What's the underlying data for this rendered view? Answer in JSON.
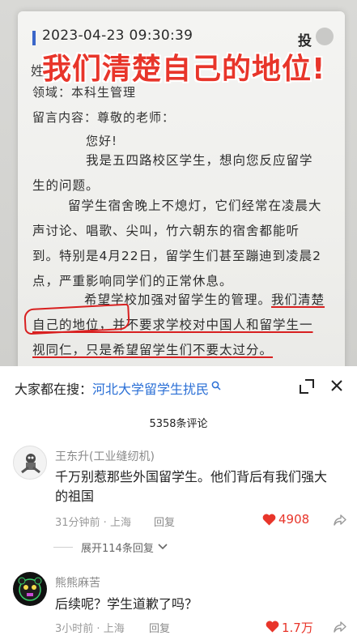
{
  "photo": {
    "timestamp": "2023-04-23 09:30:39",
    "header_right": "投",
    "overlay_title": "我们清楚自己的地位!",
    "field_partial": "姓",
    "domain_line": "领域：本科生管理",
    "content_label": "留言内容：尊敬的老师：",
    "greeting": "您好!",
    "para1": "我是五四路校区学生，想向您反应留学生的问题。",
    "para2": "留学生宿舍晚上不熄灯，它们经常在凌晨大声讨论、唱歌、尖叫，竹六朝东的宿舍都能听到。特别是4月22日，留学生们甚至蹦迪到凌晨2点，严重影响同学们的正常休息。",
    "para3_a": "希望学校加强对留学生的管理。",
    "para3_b": "我们清楚自己的地位",
    "para3_c": "，并不要求学校对中国人和留学生一视同仁，只是希望留学生们不要太过分。"
  },
  "search": {
    "prefix": "大家都在搜：",
    "term": "河北大学留学生扰民"
  },
  "comments_header": {
    "count": "5358条评论"
  },
  "comments": [
    {
      "username": "王东升(工业缝纫机)",
      "text": "千万别惹那些外国留学生。他们背后有我们强大的祖国",
      "time": "31分钟前",
      "location": "上海",
      "reply_label": "回复",
      "likes": "4908"
    },
    {
      "username": "熊熊麻苦",
      "text": "后续呢？学生道歉了吗？",
      "time": "3小时前",
      "location": "上海",
      "reply_label": "回复",
      "likes": "1.7万"
    }
  ],
  "expand_replies": "展开114条回复",
  "colors": {
    "accent_red": "#e8352a",
    "link_blue": "#2a6fd6",
    "underline_red": "#d82020"
  }
}
